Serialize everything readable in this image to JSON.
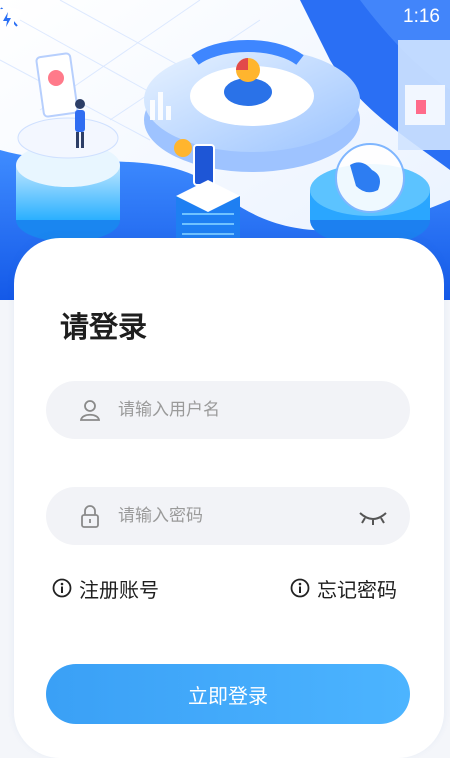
{
  "status_bar": {
    "time": "1:16",
    "icons": [
      "wifi-icon",
      "no-sim-icon",
      "battery-charging-icon"
    ]
  },
  "login": {
    "title": "请登录",
    "username_placeholder": "请输入用户名",
    "password_placeholder": "请输入密码",
    "register_label": "注册账号",
    "forgot_label": "忘记密码",
    "submit_label": "立即登录"
  },
  "theme": {
    "accent": "#3aa0f6",
    "hero_blue": "#1f6ff2",
    "field_bg": "#f2f3f7"
  }
}
